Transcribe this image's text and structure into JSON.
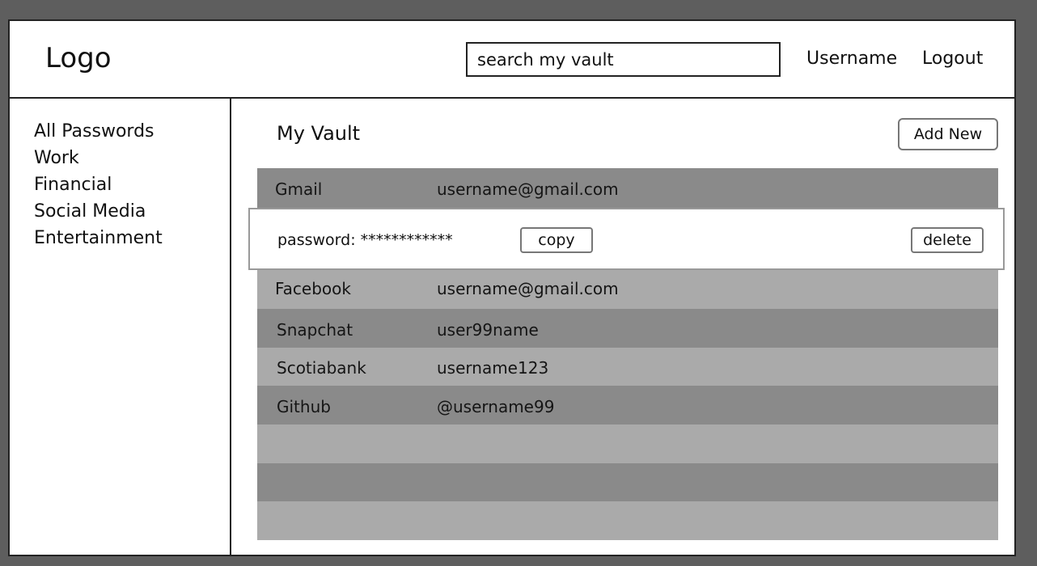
{
  "header": {
    "logo": "Logo",
    "search_placeholder": "search my vault",
    "username_label": "Username",
    "logout_label": "Logout"
  },
  "sidebar": {
    "items": [
      {
        "label": "All Passwords"
      },
      {
        "label": "Work"
      },
      {
        "label": "Financial"
      },
      {
        "label": "Social Media"
      },
      {
        "label": "Entertainment"
      }
    ]
  },
  "main": {
    "title": "My Vault",
    "add_new_label": "Add New",
    "entries": [
      {
        "site": "Gmail",
        "username": "username@gmail.com"
      },
      {
        "site": "Facebook",
        "username": "username@gmail.com"
      },
      {
        "site": "Snapchat",
        "username": "user99name"
      },
      {
        "site": "Scotiabank",
        "username": "username123"
      },
      {
        "site": "Github",
        "username": "@username99"
      }
    ],
    "expanded_entry": {
      "password_label": "password: ************",
      "copy_label": "copy",
      "delete_label": "delete"
    }
  },
  "colors": {
    "row_dark": "#8a8a8a",
    "row_light": "#aaaaaa",
    "background": "#5e5e5e"
  }
}
